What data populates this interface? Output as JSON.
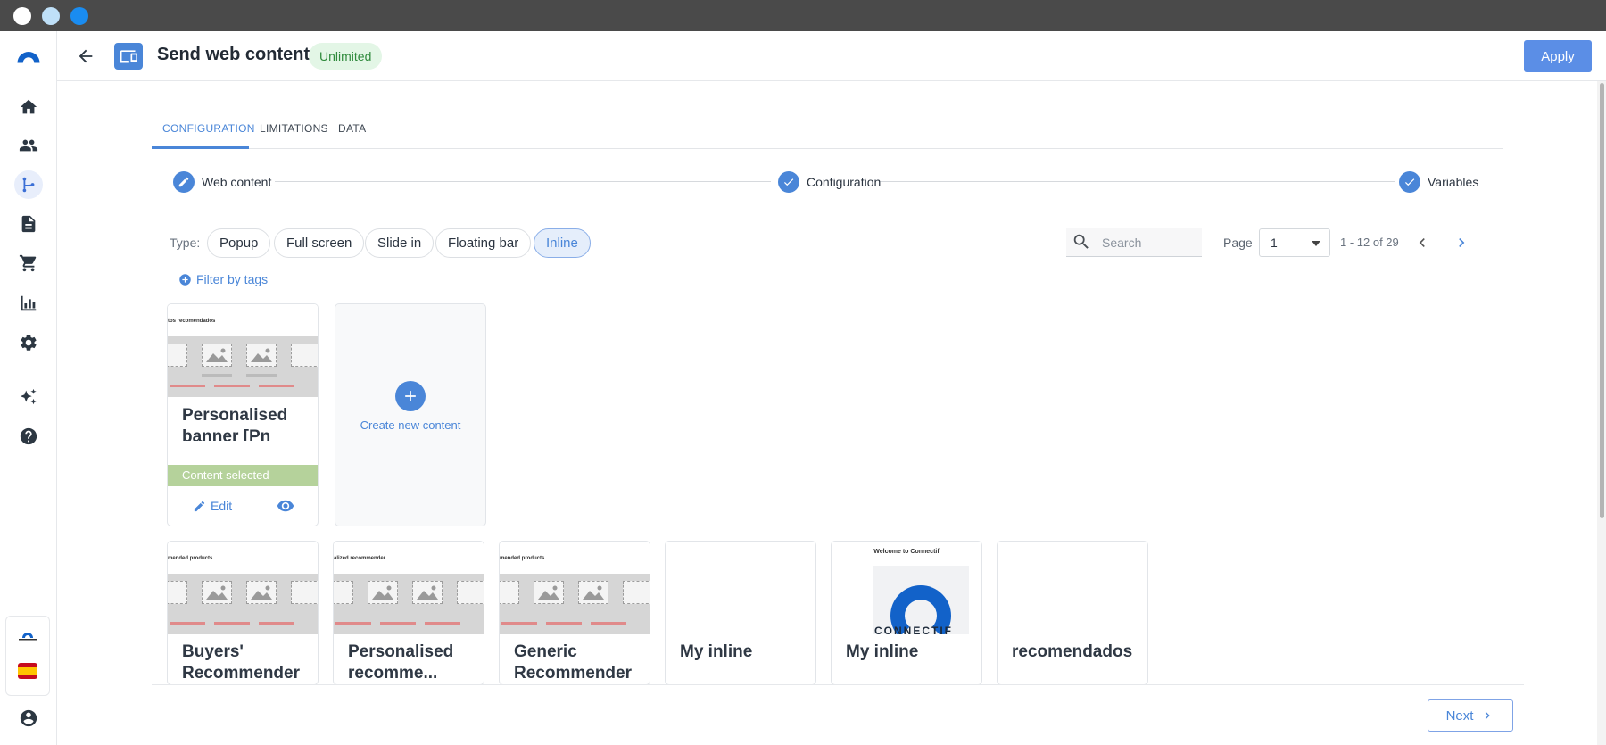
{
  "header": {
    "title": "Send web content",
    "badge": "Unlimited",
    "apply_label": "Apply"
  },
  "tabs": [
    {
      "label": "CONFIGURATION",
      "active": true
    },
    {
      "label": "LIMITATIONS",
      "active": false
    },
    {
      "label": "DATA",
      "active": false
    }
  ],
  "steps": [
    {
      "label": "Web content",
      "icon": "pencil-icon"
    },
    {
      "label": "Configuration",
      "icon": "check-icon"
    },
    {
      "label": "Variables",
      "icon": "check-icon"
    }
  ],
  "filters": {
    "type_label": "Type:",
    "chips": [
      {
        "label": "Popup",
        "selected": false
      },
      {
        "label": "Full screen",
        "selected": false
      },
      {
        "label": "Slide in",
        "selected": false
      },
      {
        "label": "Floating bar",
        "selected": false
      },
      {
        "label": "Inline",
        "selected": true
      }
    ],
    "filter_tags_label": "Filter by tags"
  },
  "search": {
    "placeholder": "Search",
    "value": ""
  },
  "pagination": {
    "page_label": "Page",
    "page_value": "1",
    "range_text": "1 - 12 of 29"
  },
  "cards_row1": [
    {
      "title": "Personalised banner [Pn",
      "thumb_caption": "tos recomendados",
      "selected_label": "Content selected",
      "edit_label": "Edit"
    }
  ],
  "create_card": {
    "label": "Create new content"
  },
  "cards_row2": [
    {
      "title": "Buyers' Recommender",
      "thumb_caption": "mended products"
    },
    {
      "title": "Personalised recomme...",
      "thumb_caption": "alized recommender"
    },
    {
      "title": "Generic Recommender",
      "thumb_caption": "mended products"
    },
    {
      "title": "My inline",
      "thumb_caption": ""
    },
    {
      "title": "My inline",
      "thumb_caption": "Welcome to Connectif",
      "logo_text": "CONNECTIF"
    },
    {
      "title": "recomendados",
      "thumb_caption": ""
    }
  ],
  "footer": {
    "next_label": "Next"
  },
  "colors": {
    "accent": "#4a86d8",
    "badge_bg": "#e3f6e6",
    "badge_text": "#2f8a3c",
    "selected_band": "#b5d29b"
  }
}
